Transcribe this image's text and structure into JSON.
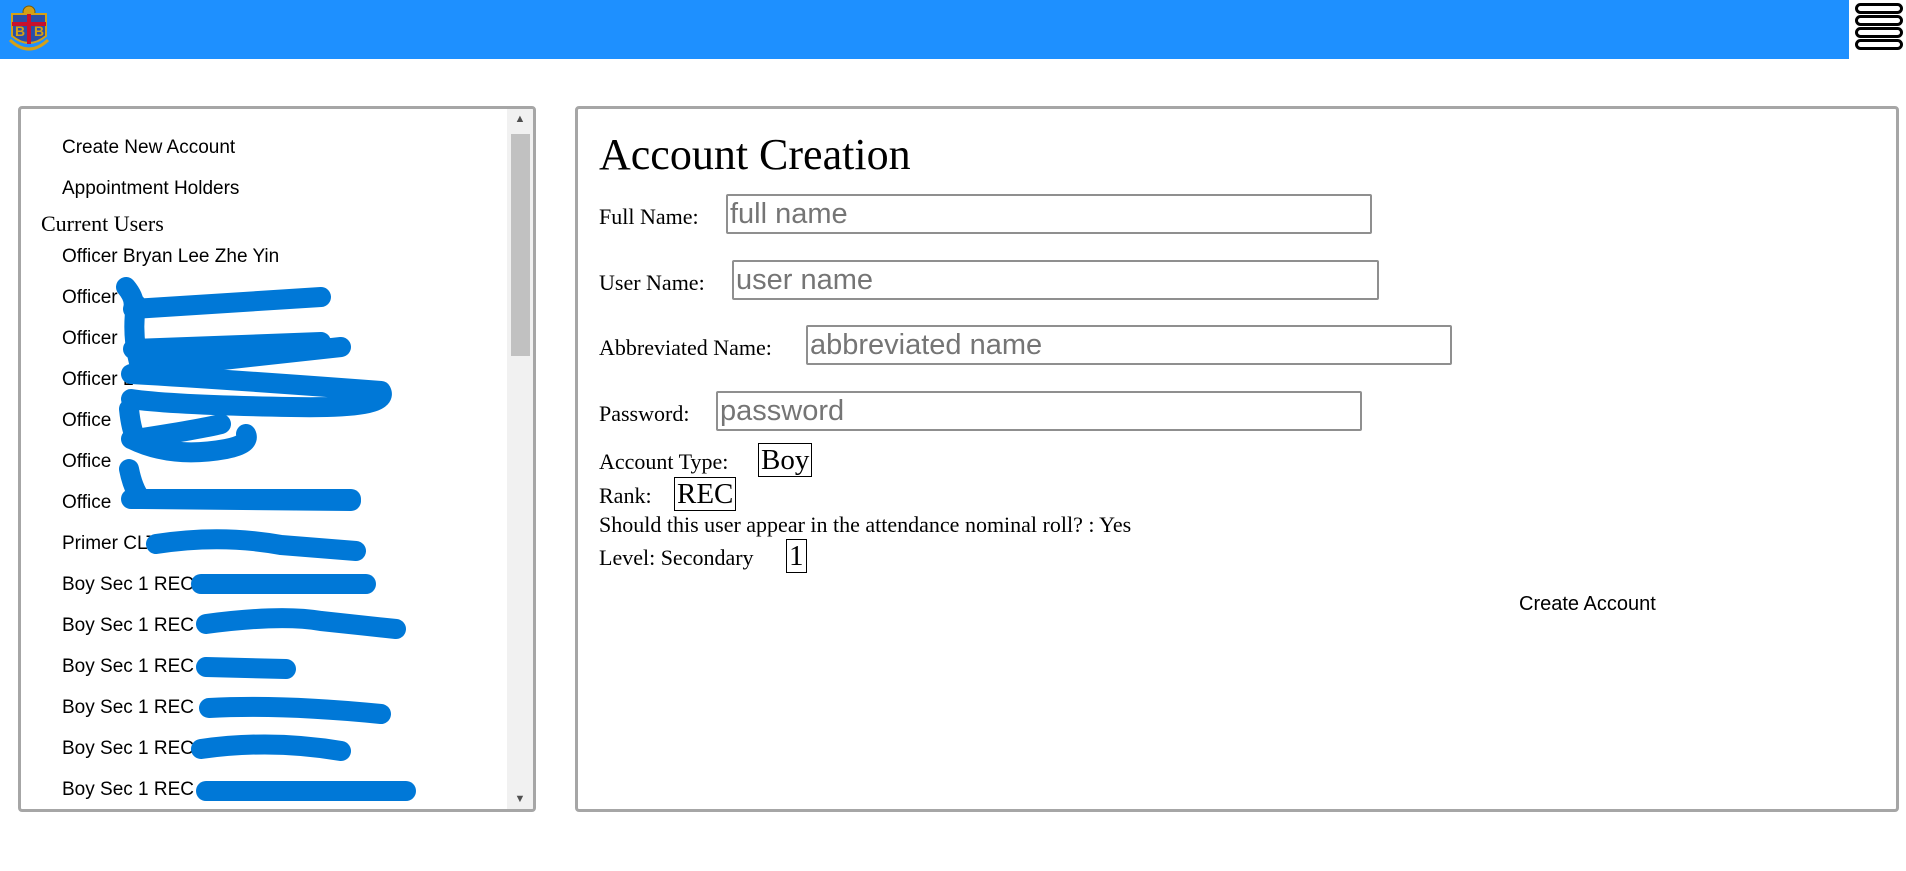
{
  "header": {
    "logo_letters": [
      "B",
      "B"
    ],
    "logo_caption": "BB"
  },
  "sidebar": {
    "items": [
      {
        "label": "Create New Account"
      },
      {
        "label": "Appointment Holders"
      }
    ],
    "section_title": "Current Users",
    "users": [
      {
        "label": "Officer Bryan Lee Zhe Yin"
      },
      {
        "label": "Officer"
      },
      {
        "label": "Officer"
      },
      {
        "label": "Officer L"
      },
      {
        "label": "Office"
      },
      {
        "label": "Office"
      },
      {
        "label": "Office"
      },
      {
        "label": "Primer CLT"
      },
      {
        "label": "Boy Sec 1 REC"
      },
      {
        "label": "Boy Sec 1 REC"
      },
      {
        "label": "Boy Sec 1 REC"
      },
      {
        "label": "Boy Sec 1 REC"
      },
      {
        "label": "Boy Sec 1 REC"
      },
      {
        "label": "Boy Sec 1 REC"
      }
    ]
  },
  "redaction_color": "#0078d7",
  "main": {
    "title": "Account Creation",
    "fields": {
      "full_name": {
        "label": "Full Name:",
        "placeholder": "full name",
        "value": ""
      },
      "user_name": {
        "label": "User Name:",
        "placeholder": "user name",
        "value": ""
      },
      "abbreviated_name": {
        "label": "Abbreviated Name:",
        "placeholder": "abbreviated name",
        "value": ""
      },
      "password": {
        "label": "Password:",
        "placeholder": "password",
        "value": ""
      }
    },
    "account_type": {
      "label": "Account Type:",
      "value": "Boy"
    },
    "rank": {
      "label": "Rank:",
      "value": "REC"
    },
    "nominal_roll": {
      "text": "Should this user appear in the attendance nominal roll? : Yes"
    },
    "level": {
      "label": "Level: Secondary",
      "value": "1"
    },
    "create_button": "Create Account"
  },
  "colors": {
    "topbar": "#1e90ff",
    "panel_border": "#a6a6a6"
  }
}
